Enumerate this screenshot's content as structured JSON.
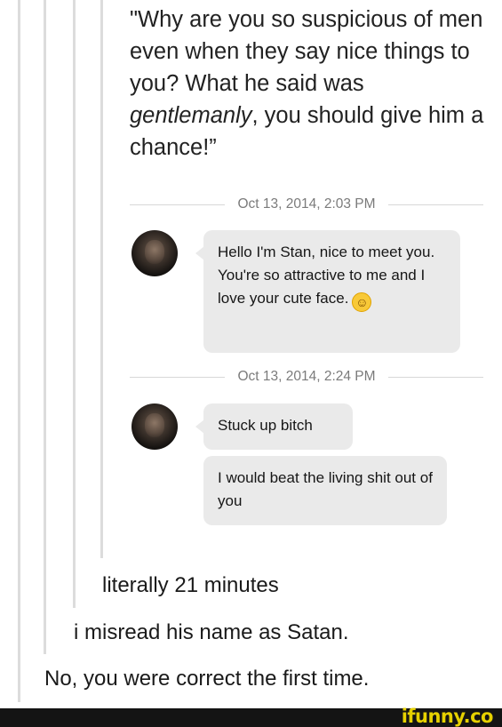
{
  "quote": {
    "part1": "\"Why are you so suspicious of men even when they say nice things to you? What he said was ",
    "emphasis": "gentlemanly",
    "part2": ", you should give him a chance!”"
  },
  "chat": {
    "timestamp_1": "Oct 13, 2014, 2:03 PM",
    "message_1": "Hello I'm Stan, nice to meet you. You're so attractive to me and I love your cute face.",
    "emoji_1": "smiling-face-emoji",
    "timestamp_2": "Oct 13, 2014, 2:24 PM",
    "message_2": "Stuck up bitch",
    "message_3": "I would beat the living shit out of you"
  },
  "replies": {
    "reply_1": "literally 21 minutes",
    "reply_2": "i misread his name as Satan.",
    "reply_3": "No, you were correct the first time."
  },
  "footer": {
    "brand": "ifunny.co"
  },
  "colors": {
    "bubble": "#eaeaea",
    "quote_bar": "#dcdcdc",
    "footer_bg": "#141414",
    "brand": "#e6d100"
  }
}
